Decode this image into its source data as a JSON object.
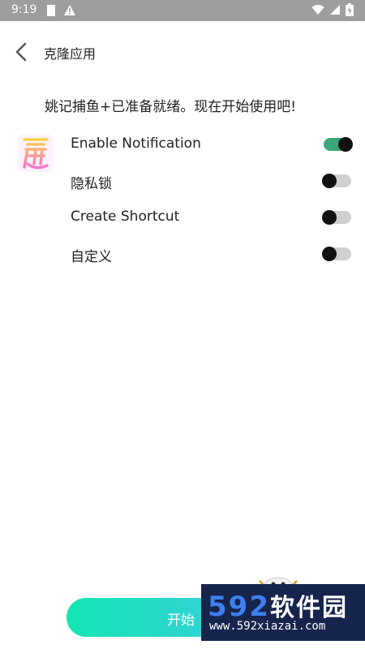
{
  "status_bar": {
    "time": "9:19"
  },
  "header": {
    "title": "克隆应用"
  },
  "message": "姚记捕鱼+已准备就绪。现在开始使用吧!",
  "settings": [
    {
      "label": "Enable Notification",
      "enabled": true
    },
    {
      "label": "隐私锁",
      "enabled": false
    },
    {
      "label": "Create Shortcut",
      "enabled": false
    },
    {
      "label": "自定义",
      "enabled": false
    }
  ],
  "start_button": {
    "label": "开始"
  },
  "watermark": {
    "brand": "592",
    "brand_cn": "软件园",
    "url": "www.592xiazai.com"
  },
  "colors": {
    "toggle_on": "#3aa67a",
    "button_start": "#14e6b4",
    "button_end": "#62c4ea",
    "watermark_bg": "#17254d"
  },
  "icons": [
    "back-chevron-icon",
    "app-logo-icon",
    "wifi-icon",
    "signal-icon",
    "battery-icon",
    "warning-icon"
  ]
}
